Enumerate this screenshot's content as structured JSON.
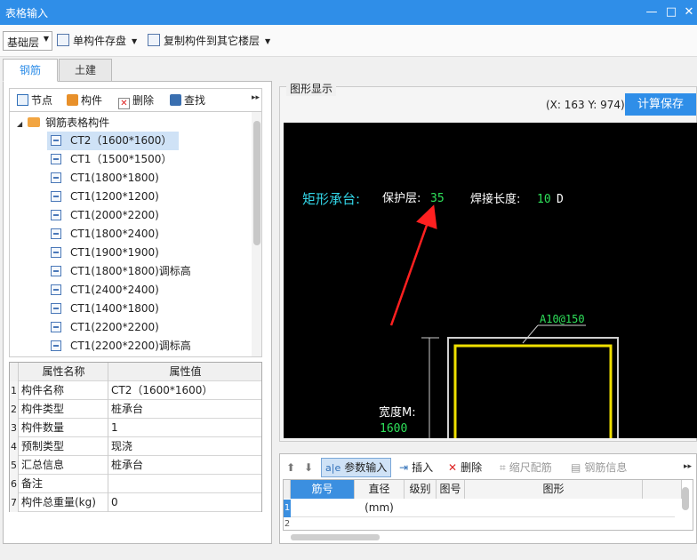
{
  "window": {
    "title": "表格输入",
    "minimize": "—",
    "maximize": "□",
    "close": "✕"
  },
  "toolbar": {
    "floor": "基础层",
    "save_component": "单构件存盘",
    "copy_to_floors": "复制构件到其它楼层"
  },
  "tabs": [
    {
      "label": "钢筋"
    },
    {
      "label": "土建"
    }
  ],
  "tree_toolbar": {
    "node": "节点",
    "component": "构件",
    "delete": "删除",
    "find": "查找"
  },
  "tree": {
    "root": "钢筋表格构件",
    "items": [
      {
        "label": "CT2（1600*1600）"
      },
      {
        "label": "CT1（1500*1500）"
      },
      {
        "label": "CT1(1800*1800)"
      },
      {
        "label": "CT1(1200*1200)"
      },
      {
        "label": "CT1(2000*2200)"
      },
      {
        "label": "CT1(1800*2400)"
      },
      {
        "label": "CT1(1900*1900)"
      },
      {
        "label": "CT1(1800*1800)调标高"
      },
      {
        "label": "CT1(2400*2400)"
      },
      {
        "label": "CT1(1400*1800)"
      },
      {
        "label": "CT1(2200*2200)"
      },
      {
        "label": "CT1(2200*2200)调标高"
      }
    ]
  },
  "properties": {
    "header": {
      "name": "属性名称",
      "value": "属性值"
    },
    "rows": [
      {
        "num": "1",
        "name": "构件名称",
        "value": "CT2（1600*1600）"
      },
      {
        "num": "2",
        "name": "构件类型",
        "value": "桩承台"
      },
      {
        "num": "3",
        "name": "构件数量",
        "value": "1"
      },
      {
        "num": "4",
        "name": "预制类型",
        "value": "现浇"
      },
      {
        "num": "5",
        "name": "汇总信息",
        "value": "桩承台"
      },
      {
        "num": "6",
        "name": "备注",
        "value": ""
      },
      {
        "num": "7",
        "name": "构件总重量(kg)",
        "value": "0"
      }
    ]
  },
  "graphic": {
    "legend": "图形显示",
    "coords": "(X: 163 Y: 974)",
    "calc_save": "计算保存",
    "title": "矩形承台:",
    "cover_label": "保护层:",
    "cover_value": "35",
    "weld_label": "焊接长度:",
    "weld_value": "10",
    "weld_unit": "D",
    "rebar_label": "A10@150",
    "width_label": "宽度M:",
    "width_value": "1600",
    "colors": {
      "background": "#000000",
      "cyan": "#33d6e8",
      "green": "#2ee05a",
      "yellow": "#f0e000",
      "arrow": "#ff2020"
    }
  },
  "rebar_toolbar": {
    "param_input": "参数输入",
    "insert": "插入",
    "delete": "删除",
    "scale_config": "缩尺配筋",
    "rebar_info": "钢筋信息"
  },
  "rebar_grid": {
    "headers": [
      "筋号",
      "直径(mm)",
      "级别",
      "图号",
      "图形"
    ],
    "row_numbers": [
      "1",
      "2"
    ]
  }
}
